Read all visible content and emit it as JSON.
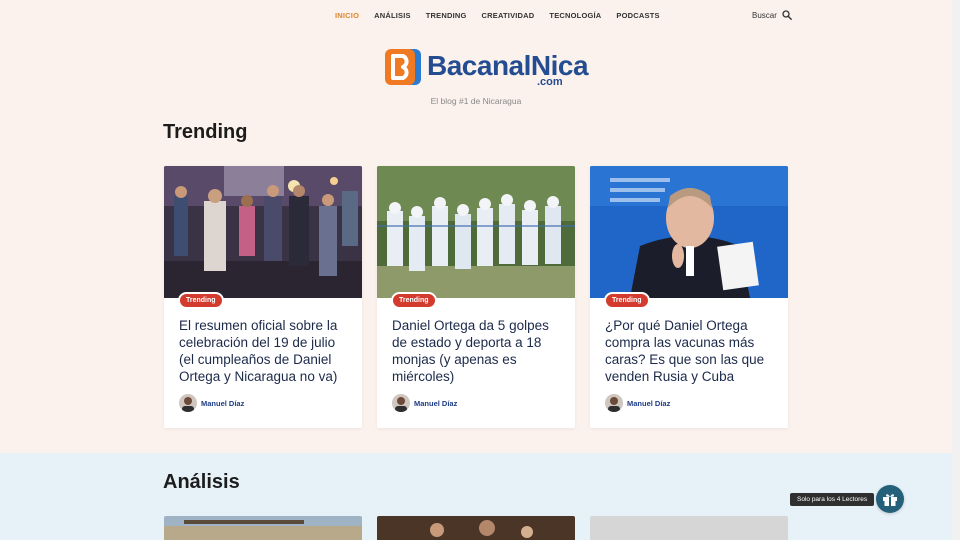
{
  "nav": {
    "items": [
      {
        "label": "INICIO",
        "active": true
      },
      {
        "label": "ANÁLISIS",
        "active": false
      },
      {
        "label": "TRENDING",
        "active": false
      },
      {
        "label": "CREATIVIDAD",
        "active": false
      },
      {
        "label": "TECNOLOGÍA",
        "active": false
      },
      {
        "label": "PODCASTS",
        "active": false
      }
    ],
    "search_label": "Buscar",
    "search_icon": "search-icon"
  },
  "logo": {
    "name": "BacanalNica",
    "domain": ".com",
    "tagline": "El blog #1 de Nicaragua"
  },
  "colors": {
    "accent": "#e0872b",
    "brand_blue": "#234c91",
    "badge_red": "#d23b2e",
    "page_bg": "#fbf1ed",
    "analisis_bg": "#e7f2f8",
    "gift_button": "#25607a"
  },
  "trending": {
    "title": "Trending",
    "cards": [
      {
        "badge": "Trending",
        "title": "El resumen oficial sobre la celebración del 19 de julio (el cumpleaños de Daniel Ortega y Nicaragua no va)",
        "author": "Manuel Díaz"
      },
      {
        "badge": "Trending",
        "title": "Daniel Ortega da 5 golpes de estado y deporta a 18 monjas (y apenas es miércoles)",
        "author": "Manuel Díaz"
      },
      {
        "badge": "Trending",
        "title": "¿Por qué Daniel Ortega compra las vacunas más caras? Es que son las que venden Rusia y Cuba",
        "author": "Manuel Díaz"
      }
    ]
  },
  "analisis": {
    "title": "Análisis"
  },
  "widget": {
    "tooltip": "Solo para los 4 Lectores",
    "icon": "gift-icon"
  }
}
